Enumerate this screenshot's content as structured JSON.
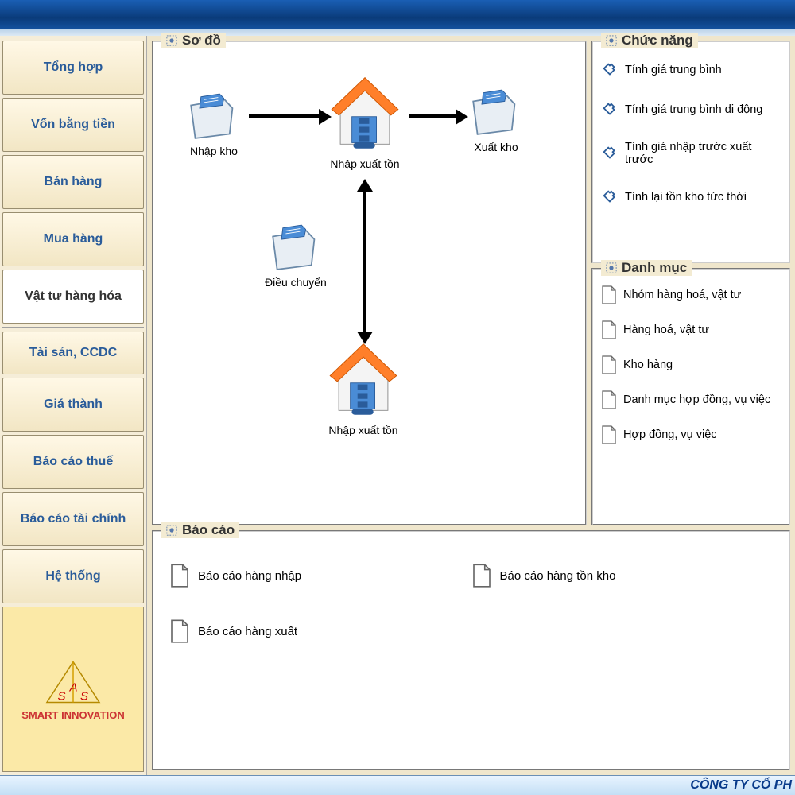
{
  "sidebar": {
    "items": [
      {
        "label": "Tổng hợp"
      },
      {
        "label": "Vốn bằng tiền"
      },
      {
        "label": "Bán hàng"
      },
      {
        "label": "Mua hàng"
      },
      {
        "label": "Vật tư hàng hóa"
      },
      {
        "label": "Tài sản, CCDC"
      },
      {
        "label": "Giá thành"
      },
      {
        "label": "Báo cáo thuế"
      },
      {
        "label": "Báo cáo tài chính"
      },
      {
        "label": "Hệ thống"
      }
    ],
    "active_index": 4,
    "logo_text": "SMART INNOVATION"
  },
  "diagram": {
    "title": "Sơ đồ",
    "nodes": {
      "nhap_kho": "Nhập kho",
      "nhap_xuat_ton_top": "Nhập xuất tồn",
      "xuat_kho": "Xuất kho",
      "dieu_chuyen": "Điều chuyển",
      "nhap_xuat_ton_bottom": "Nhập xuất tồn"
    }
  },
  "functions": {
    "title": "Chức năng",
    "items": [
      "Tính giá trung bình",
      "Tính giá trung bình di động",
      "Tính giá nhập trước xuất trước",
      "Tính lại tồn kho tức thời"
    ]
  },
  "categories": {
    "title": "Danh mục",
    "items": [
      "Nhóm hàng hoá, vật tư",
      "Hàng hoá, vật tư",
      "Kho hàng",
      "Danh mục hợp đồng, vụ việc",
      "Hợp đồng, vụ việc"
    ]
  },
  "reports": {
    "title": "Báo cáo",
    "col1": [
      "Báo cáo hàng nhập",
      "Báo cáo hàng xuất"
    ],
    "col2": [
      "Báo cáo hàng tồn kho"
    ]
  },
  "footer": {
    "company": "CÔNG TY CỔ PH"
  }
}
